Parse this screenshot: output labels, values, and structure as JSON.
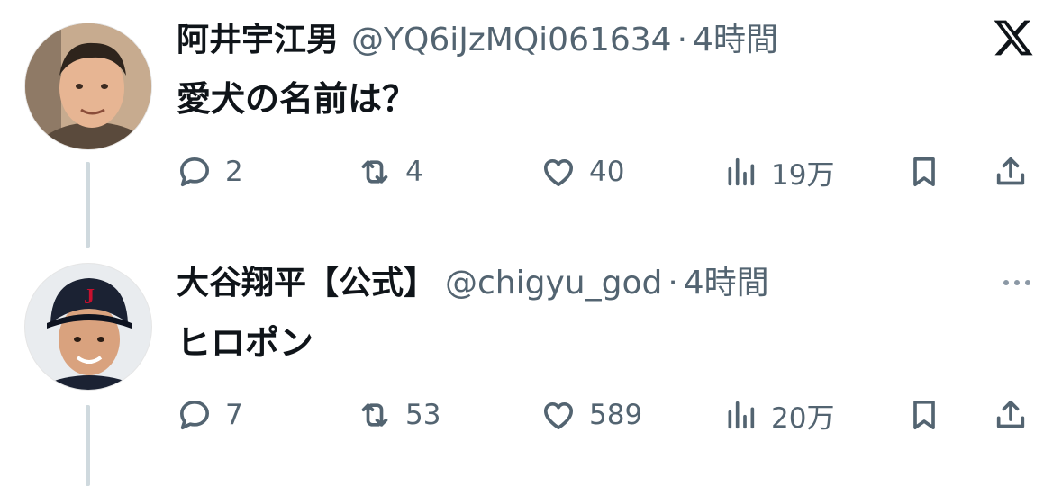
{
  "tweets": [
    {
      "name": "阿井宇江男",
      "handle": "@YQ6iJzMQi061634",
      "separator": "·",
      "time": "4時間",
      "text": "愛犬の名前は？",
      "replies": "2",
      "retweets": "4",
      "likes": "40",
      "views": "19万"
    },
    {
      "name": "大谷翔平【公式】",
      "handle": "@chigyu_god",
      "separator": "·",
      "time": "4時間",
      "text": "ヒロポン",
      "replies": "7",
      "retweets": "53",
      "likes": "589",
      "views": "20万"
    }
  ],
  "icons": {
    "top_right": "x-logo-icon",
    "more": "more-icon",
    "actions": [
      "reply-icon",
      "retweet-icon",
      "like-icon",
      "views-icon",
      "bookmark-icon",
      "share-icon"
    ]
  },
  "colors": {
    "text": "#0f1419",
    "secondary": "#536471",
    "thread_line": "#cfd9de",
    "cap_navy": "#1b2233",
    "cap_logo_red": "#c8102e"
  }
}
